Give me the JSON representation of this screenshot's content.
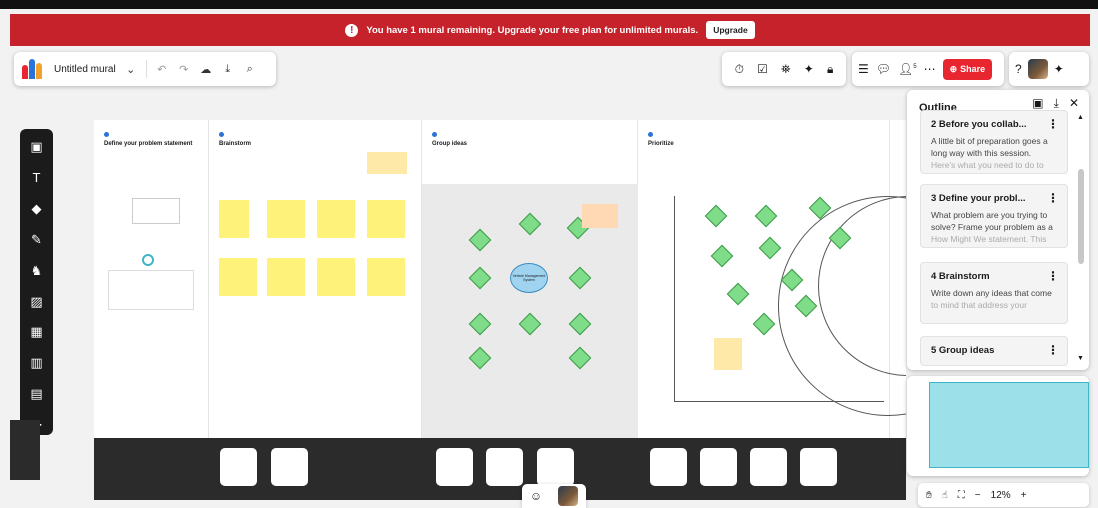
{
  "banner": {
    "message": "You have 1 mural remaining. Upgrade your free plan for unlimited murals.",
    "button": "Upgrade"
  },
  "toolbar": {
    "title": "Untitled mural",
    "share": "Share",
    "notification_count": "5"
  },
  "canvas": {
    "panels": [
      {
        "title": "Define your problem statement"
      },
      {
        "title": "Brainstorm"
      },
      {
        "title": "Group ideas"
      },
      {
        "title": "Prioritize"
      }
    ],
    "center_node": "Vehicle Management System"
  },
  "outline": {
    "heading": "Outline",
    "items": [
      {
        "title": "2  Before you collab...",
        "desc": "A little bit of preparation goes a long way with this session.",
        "fade": "Here's what you need to do to"
      },
      {
        "title": "3  Define your probl...",
        "desc": "What problem are you trying to solve? Frame your problem as a",
        "fade": "How Might We statement. This"
      },
      {
        "title": "4  Brainstorm",
        "desc": "Write down any ideas that come",
        "fade": "to mind that address your"
      },
      {
        "title": "5  Group ideas",
        "desc": "",
        "fade": ""
      }
    ]
  },
  "zoom": {
    "level": "12%"
  },
  "colors": {
    "banner": "#c5222b",
    "share": "#e8262f",
    "sticky": "#fff27a",
    "diamond": "#7fdc88",
    "minimap_viewport": "#9ce0ea"
  }
}
